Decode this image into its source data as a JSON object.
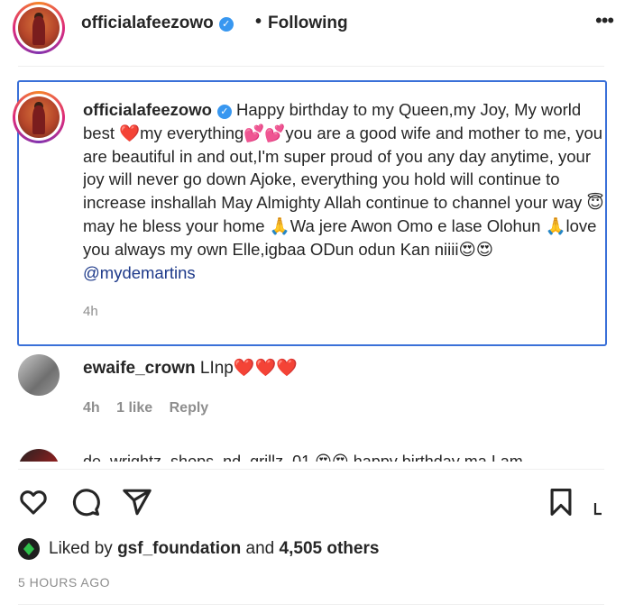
{
  "header": {
    "username": "officialafeezowo",
    "separator": "•",
    "follow_status": "Following",
    "more_icon": "more-dots-icon"
  },
  "caption": {
    "username": "officialafeezowo",
    "text": "Happy birthday to my Queen,my Joy, My world best ❤️my everything💕💕you are a good wife and mother to me, you are beautiful in and out,I'm super proud of you any day anytime, your joy will never go down Ajoke, everything you hold will continue to increase inshallah May Almighty Allah continue to channel your way 😇 may he bless your home 🙏Wa jere Awon Omo e lase Olohun 🙏love you always my own Elle,igbaa ODun odun Kan niiii😍😍",
    "mention": "@mydemartins",
    "time": "4h"
  },
  "comment": {
    "username": "ewaife_crown",
    "text": "LInp❤️❤️❤️",
    "time": "4h",
    "likes": "1 like",
    "reply": "Reply"
  },
  "cut_comment": {
    "text": "de_wrightz_shops_nd_grillz_01 😍😍 happy birthday ma I am"
  },
  "actions": {
    "like_icon": "heart-icon",
    "comment_icon": "comment-icon",
    "share_icon": "send-icon",
    "save_icon": "bookmark-icon"
  },
  "likes": {
    "prefix": "Liked by",
    "user": "gsf_foundation",
    "middle": "and",
    "others": "4,505 others"
  },
  "timestamp": "5 HOURS AGO",
  "colors": {
    "accent": "#3897f0",
    "selection_border": "#3a70d8",
    "muted": "#8e8e8e"
  }
}
